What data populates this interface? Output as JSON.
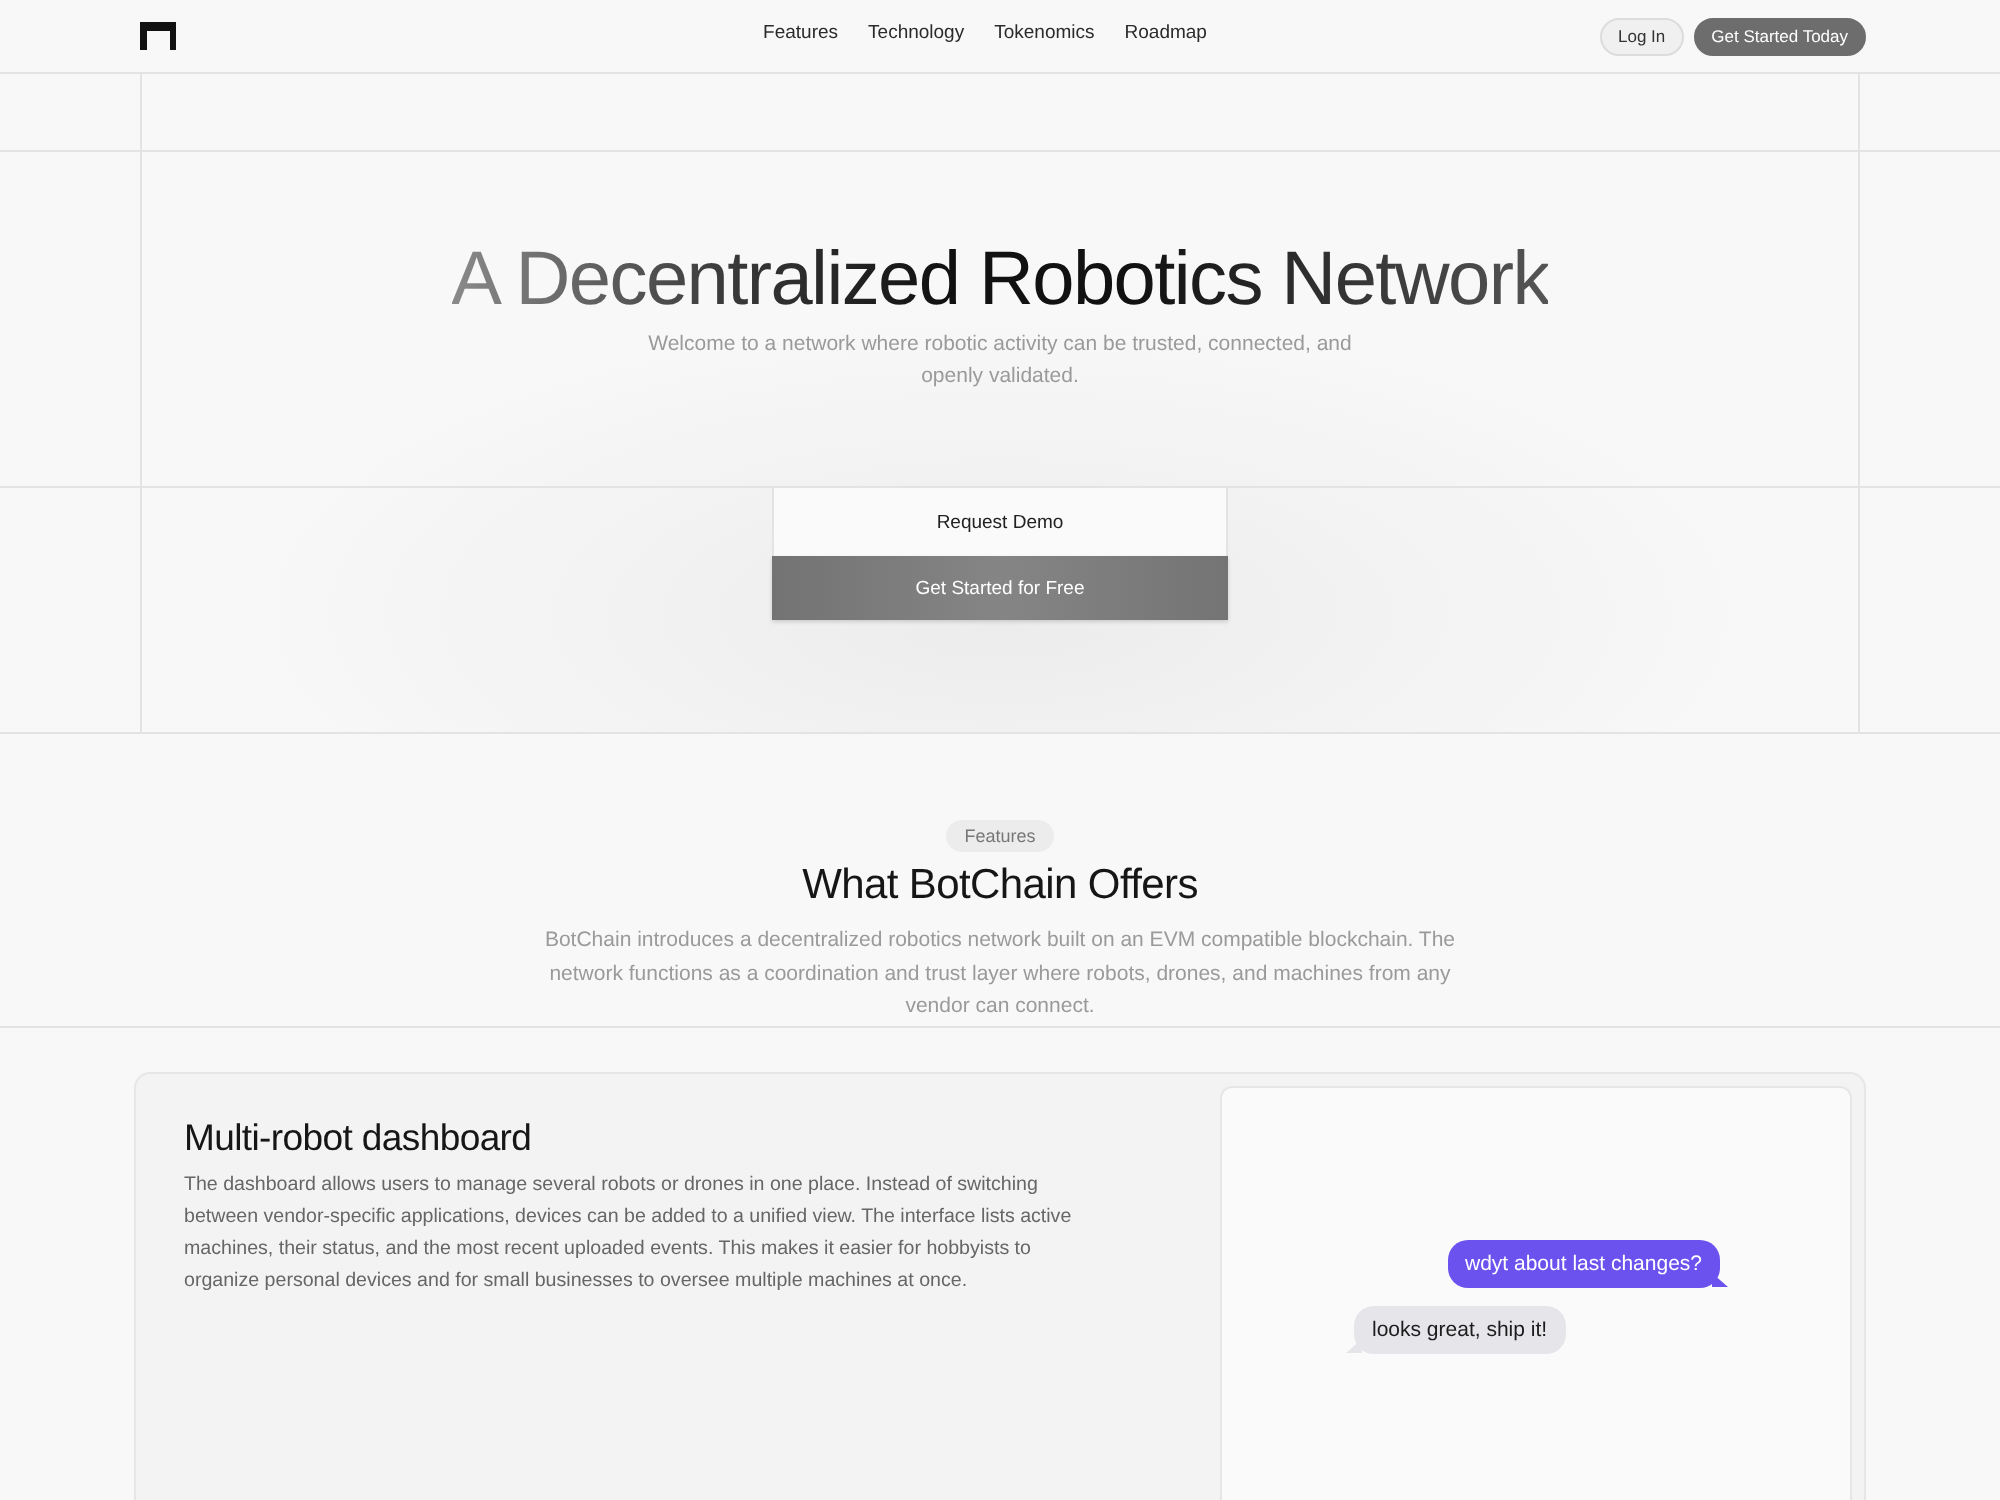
{
  "header": {
    "nav": [
      {
        "label": "Features"
      },
      {
        "label": "Technology"
      },
      {
        "label": "Tokenomics"
      },
      {
        "label": "Roadmap"
      }
    ],
    "login_button": "Log In",
    "cta_button": "Get Started Today"
  },
  "hero": {
    "title": "A Decentralized Robotics Network",
    "subtitle": "Welcome to a network where robotic activity can be trusted, connected, and openly validated.",
    "buttons": [
      {
        "label": "Request Demo",
        "kind": "secondary"
      },
      {
        "label": "Get Started for Free",
        "kind": "primary"
      }
    ]
  },
  "features": {
    "badge": "Features",
    "heading": "What BotChain Offers",
    "description": "BotChain introduces a decentralized robotics network built on an EVM compatible blockchain. The network functions as a coordination and trust layer where robots, drones, and machines from any vendor can connect."
  },
  "feature_card": {
    "title": "Multi-robot dashboard",
    "description": "The dashboard allows users to manage several robots or drones in one place. Instead of switching between vendor-specific applications, devices can be added to a unified view. The interface lists active machines, their status, and the most recent uploaded events. This makes it easier for hobbyists to organize personal devices and for small businesses to oversee multiple machines at once.",
    "chat": [
      {
        "text": "wdyt about last changes?",
        "kind": "sent"
      },
      {
        "text": "looks great, ship it!",
        "kind": "received"
      }
    ]
  }
}
